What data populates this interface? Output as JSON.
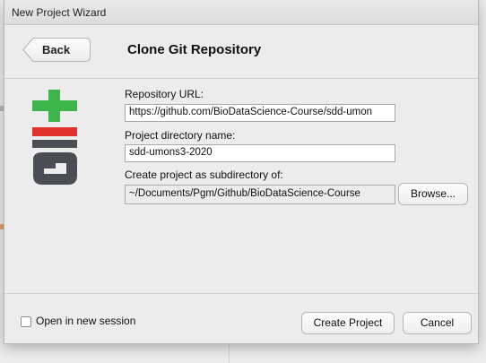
{
  "window": {
    "title": "New Project Wizard"
  },
  "header": {
    "back_label": "Back",
    "title": "Clone Git Repository"
  },
  "logo": {
    "name": "git-logo",
    "colors": {
      "plus": "#3db54a",
      "bar": "#e0312f",
      "letters": "#4a4d51"
    }
  },
  "form": {
    "repo_url": {
      "label": "Repository URL:",
      "value": "https://github.com/BioDataScience-Course/sdd-umon"
    },
    "dir_name": {
      "label": "Project directory name:",
      "value": "sdd-umons3-2020"
    },
    "subdir": {
      "label": "Create project as subdirectory of:",
      "value": "~/Documents/Pgm/Github/BioDataScience-Course",
      "browse_label": "Browse..."
    }
  },
  "footer": {
    "open_new_session_label": "Open in new session",
    "open_new_session_checked": false,
    "create_label": "Create Project",
    "cancel_label": "Cancel"
  }
}
